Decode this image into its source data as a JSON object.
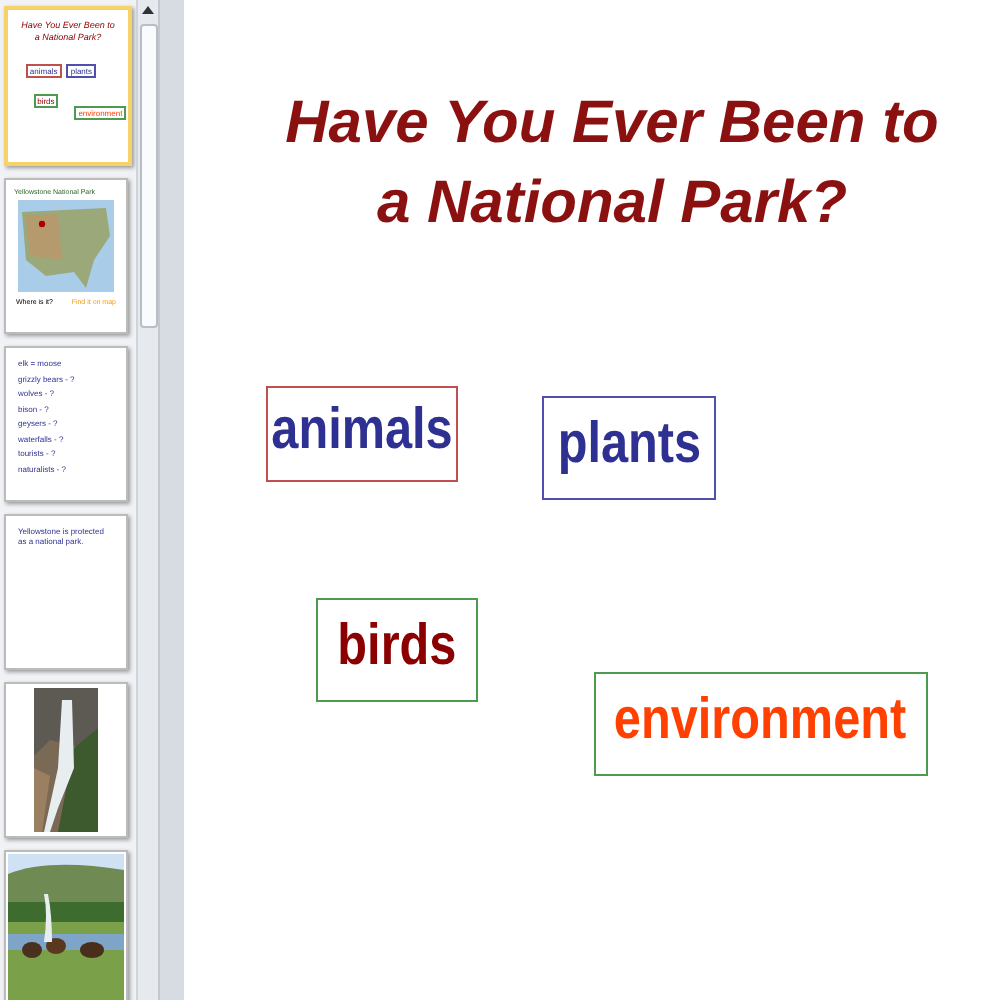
{
  "thumbnails": [
    {
      "kind": "title-slide",
      "selected": true,
      "title": "Have You Ever Been to a National Park?",
      "words": [
        "animals",
        "plants",
        "birds",
        "environment"
      ]
    },
    {
      "kind": "map",
      "selected": false,
      "heading": "Yellowstone National Park",
      "caption_left": "Where is it?",
      "caption_right": "Find it on map"
    },
    {
      "kind": "list",
      "selected": false,
      "lines": [
        "elk = moose",
        "grizzly bears - ?",
        "wolves - ?",
        "bison - ?",
        "geysers - ?",
        "waterfalls - ?",
        "tourists - ?",
        "naturalists - ?"
      ]
    },
    {
      "kind": "sentence",
      "selected": false,
      "text": "Yellowstone is protected as a national park."
    },
    {
      "kind": "waterfall",
      "selected": false
    },
    {
      "kind": "meadow",
      "selected": false
    }
  ],
  "slide": {
    "title": "Have You Ever Been to a National Park?",
    "words": [
      {
        "text": "animals",
        "color": "#2e3192",
        "frame": {
          "color": "#c0504d"
        }
      },
      {
        "text": "plants",
        "color": "#2e3192",
        "frame": {
          "color": "#4f4fb0"
        }
      },
      {
        "text": "birds",
        "color": "#8b0000",
        "frame": {
          "color": "#4e9a4e"
        }
      },
      {
        "text": "environment",
        "color": "#ff4000",
        "frame": {
          "color": "#4e9a4e"
        }
      }
    ]
  }
}
